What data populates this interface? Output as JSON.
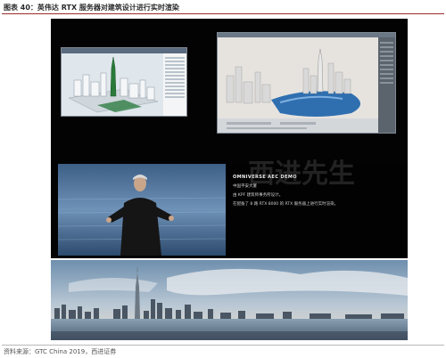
{
  "figure": {
    "caption": "图表 40：英伟达 RTX 服务器对建筑设计进行实时渲染",
    "source": "资料来源：GTC China 2019，西进证券"
  },
  "slide": {
    "title": "OMNIVERSE AEC DEMO",
    "lines": [
      "中国平安大厦",
      "由 KPF 建筑师事务所设计。",
      "在配备了 8 路 RTX 8000 的 RTX 服务器上进行实时渲染。"
    ]
  },
  "watermark": "西进先生",
  "colors": {
    "panel_background": "#030303",
    "caption_rule": "#9a2b2b",
    "water_blue": "#2f6fb0"
  }
}
